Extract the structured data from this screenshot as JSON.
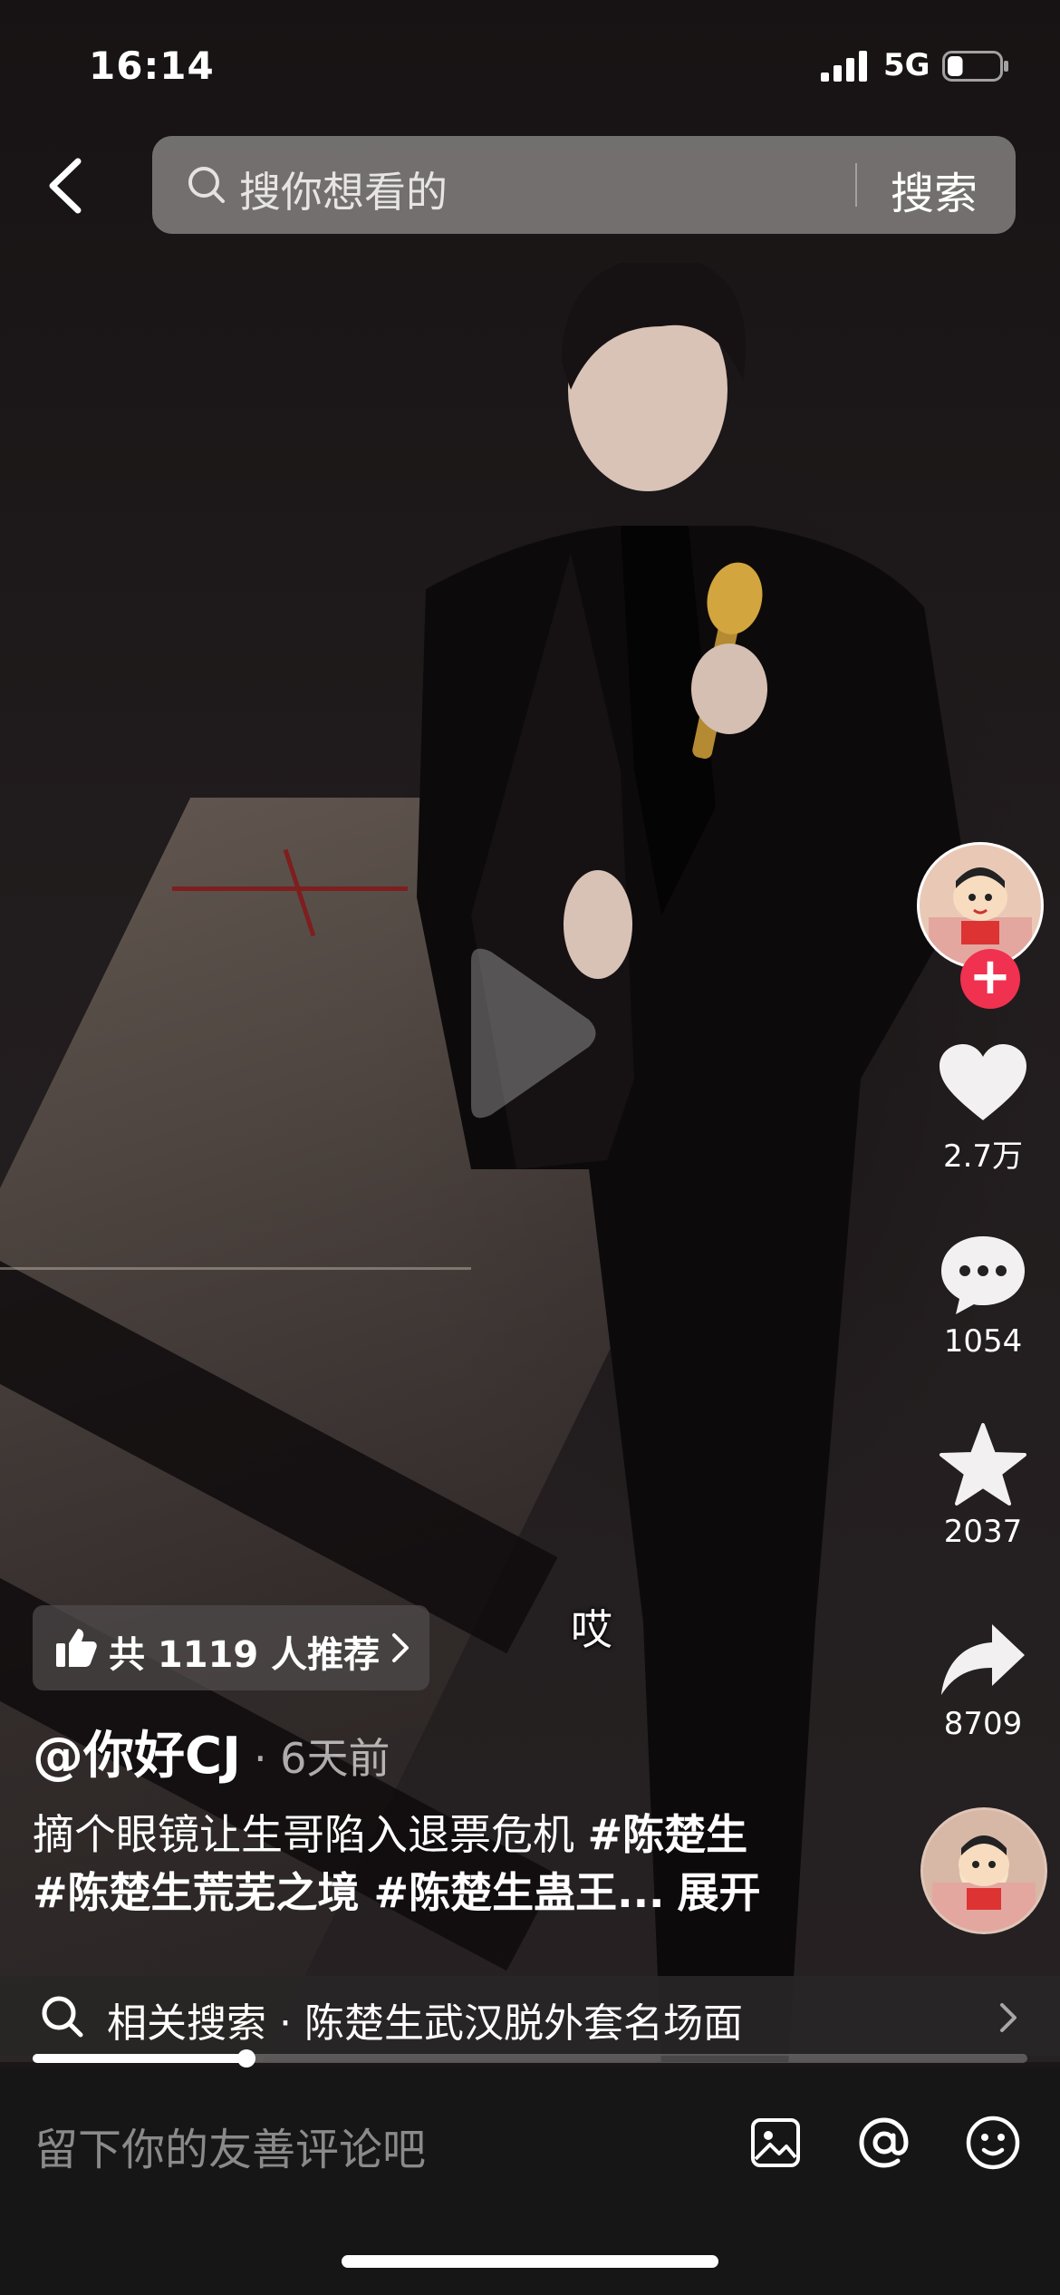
{
  "status_bar": {
    "time": "16:14",
    "network": "5G",
    "battery_level": 0.3
  },
  "search": {
    "placeholder": "搜你想看的",
    "button_label": "搜索"
  },
  "video": {
    "caption": "哎"
  },
  "side_rail": {
    "likes": "2.7万",
    "comments": "1054",
    "favorites": "2037",
    "shares": "8709"
  },
  "recommend": {
    "label": "共 1119 人推荐"
  },
  "author": {
    "name": "@你好CJ",
    "time_ago": "· 6天前"
  },
  "description": {
    "text": "摘个眼镜让生哥陷入退票危机",
    "tags_line1": "#陈楚生",
    "tags_line2": "#陈楚生荒芜之境 #陈楚生蛊王...",
    "expand": "展开"
  },
  "related_search": {
    "label": "相关搜索 · 陈楚生武汉脱外套名场面"
  },
  "playback": {
    "progress": 0.215
  },
  "comment_bar": {
    "placeholder": "留下你的友善评论吧"
  },
  "colors": {
    "follow_red": "#f0314f",
    "background": "#1b1718"
  },
  "icons": [
    "back-icon",
    "search-icon",
    "play-icon",
    "heart-icon",
    "comment-icon",
    "star-icon",
    "share-icon",
    "thumbs-up-icon",
    "image-icon",
    "at-icon",
    "emoji-icon"
  ]
}
